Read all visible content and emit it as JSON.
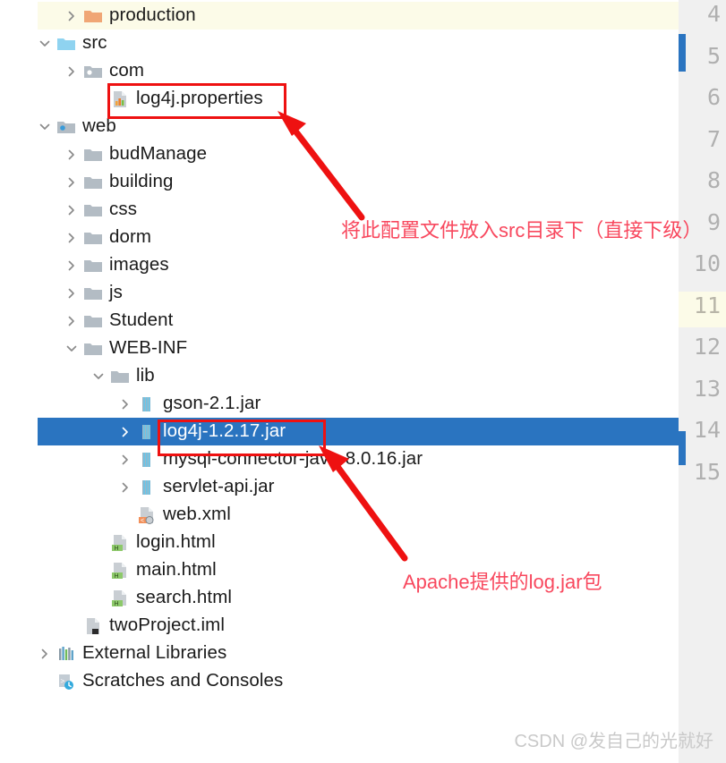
{
  "window": {
    "kind": "ide-project-tree",
    "selection_color": "#2a74c0",
    "highlight_color": "#fcfbe8",
    "annotation_color": "#f8485e",
    "box_color": "#ee1111"
  },
  "tree": {
    "items": [
      {
        "label": "production",
        "icon": "folder-orange",
        "chevron": "right",
        "depth": 2,
        "state": "highlighted"
      },
      {
        "label": "src",
        "icon": "folder-blue",
        "chevron": "down",
        "depth": 1,
        "state": "normal"
      },
      {
        "label": "com",
        "icon": "folder-package-gray",
        "chevron": "right",
        "depth": 2,
        "state": "normal"
      },
      {
        "label": "log4j.properties",
        "icon": "file-properties-chart",
        "chevron": "none",
        "depth": 3,
        "state": "boxed"
      },
      {
        "label": "web",
        "icon": "folder-web-blue-dot",
        "chevron": "down",
        "depth": 1,
        "state": "normal"
      },
      {
        "label": "budManage",
        "icon": "folder-gray",
        "chevron": "right",
        "depth": 2,
        "state": "normal"
      },
      {
        "label": "building",
        "icon": "folder-gray",
        "chevron": "right",
        "depth": 2,
        "state": "normal"
      },
      {
        "label": "css",
        "icon": "folder-gray",
        "chevron": "right",
        "depth": 2,
        "state": "normal"
      },
      {
        "label": "dorm",
        "icon": "folder-gray",
        "chevron": "right",
        "depth": 2,
        "state": "normal"
      },
      {
        "label": "images",
        "icon": "folder-gray",
        "chevron": "right",
        "depth": 2,
        "state": "normal"
      },
      {
        "label": "js",
        "icon": "folder-gray",
        "chevron": "right",
        "depth": 2,
        "state": "normal"
      },
      {
        "label": "Student",
        "icon": "folder-gray",
        "chevron": "right",
        "depth": 2,
        "state": "normal"
      },
      {
        "label": "WEB-INF",
        "icon": "folder-gray",
        "chevron": "down",
        "depth": 2,
        "state": "normal"
      },
      {
        "label": "lib",
        "icon": "folder-gray",
        "chevron": "down",
        "depth": 3,
        "state": "normal"
      },
      {
        "label": "gson-2.1.jar",
        "icon": "file-jar",
        "chevron": "right",
        "depth": 4,
        "state": "normal"
      },
      {
        "label": "log4j-1.2.17.jar",
        "icon": "file-jar",
        "chevron": "right",
        "depth": 4,
        "state": "selected"
      },
      {
        "label": "mysql-connector-java-8.0.16.jar",
        "icon": "file-jar",
        "chevron": "right",
        "depth": 4,
        "state": "normal"
      },
      {
        "label": "servlet-api.jar",
        "icon": "file-jar",
        "chevron": "right",
        "depth": 4,
        "state": "normal"
      },
      {
        "label": "web.xml",
        "icon": "file-xml-web",
        "chevron": "none",
        "depth": 4,
        "state": "normal"
      },
      {
        "label": "login.html",
        "icon": "file-html",
        "chevron": "none",
        "depth": 3,
        "state": "normal"
      },
      {
        "label": "main.html",
        "icon": "file-html",
        "chevron": "none",
        "depth": 3,
        "state": "normal"
      },
      {
        "label": "search.html",
        "icon": "file-html",
        "chevron": "none",
        "depth": 3,
        "state": "normal"
      },
      {
        "label": "twoProject.iml",
        "icon": "file-iml",
        "chevron": "none",
        "depth": 2,
        "state": "normal"
      },
      {
        "label": "External Libraries",
        "icon": "libraries-bars",
        "chevron": "right",
        "depth": 1,
        "state": "normal"
      },
      {
        "label": "Scratches and Consoles",
        "icon": "scratches-clock",
        "chevron": "none",
        "depth": 1,
        "state": "normal"
      }
    ]
  },
  "gutter": {
    "line_numbers": [
      "4",
      "5",
      "6",
      "7",
      "8",
      "9",
      "10",
      "11",
      "12",
      "13",
      "14",
      "15"
    ],
    "highlighted_line": "11",
    "selected_line": "14"
  },
  "annotations": {
    "arrow_1_note": "将此配置文件放入src目录下（直接下级）",
    "arrow_2_note": "Apache提供的log.jar包"
  },
  "watermark": "CSDN @发自己的光就好"
}
